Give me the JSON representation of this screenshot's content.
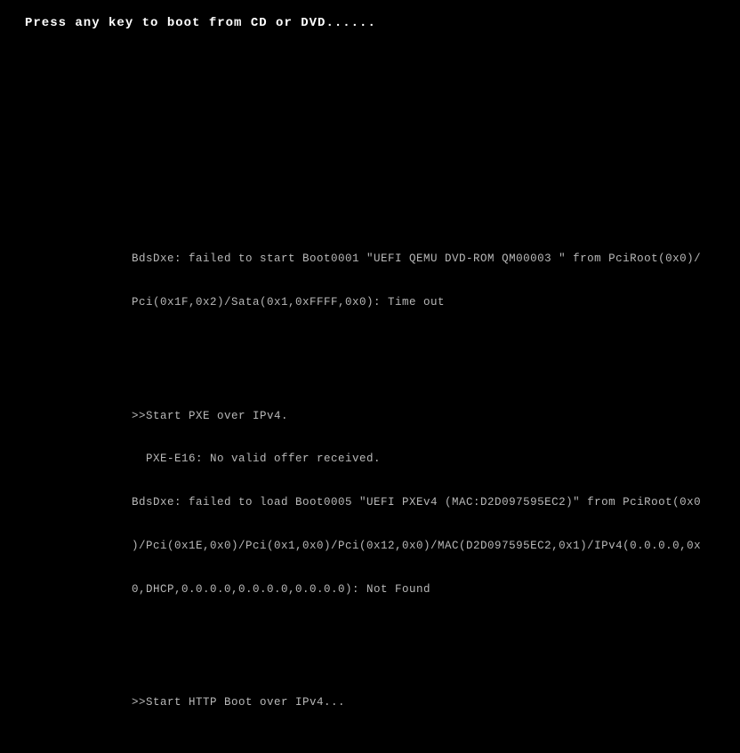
{
  "prompt": {
    "text": "Press any key to boot from CD or DVD......"
  },
  "boot": {
    "block1": {
      "line1": "BdsDxe: failed to start Boot0001 \"UEFI QEMU DVD-ROM QM00003 \" from PciRoot(0x0)/",
      "line2": "Pci(0x1F,0x2)/Sata(0x1,0xFFFF,0x0): Time out"
    },
    "block2": {
      "line1": ">>Start PXE over IPv4.",
      "line2": "  PXE-E16: No valid offer received.",
      "line3": "BdsDxe: failed to load Boot0005 \"UEFI PXEv4 (MAC:D2D097595EC2)\" from PciRoot(0x0",
      "line4": ")/Pci(0x1E,0x0)/Pci(0x1,0x0)/Pci(0x12,0x0)/MAC(D2D097595EC2,0x1)/IPv4(0.0.0.0,0x",
      "line5": "0,DHCP,0.0.0.0,0.0.0.0,0.0.0.0): Not Found"
    },
    "block3": {
      "line1": ">>Start HTTP Boot over IPv4..."
    }
  }
}
